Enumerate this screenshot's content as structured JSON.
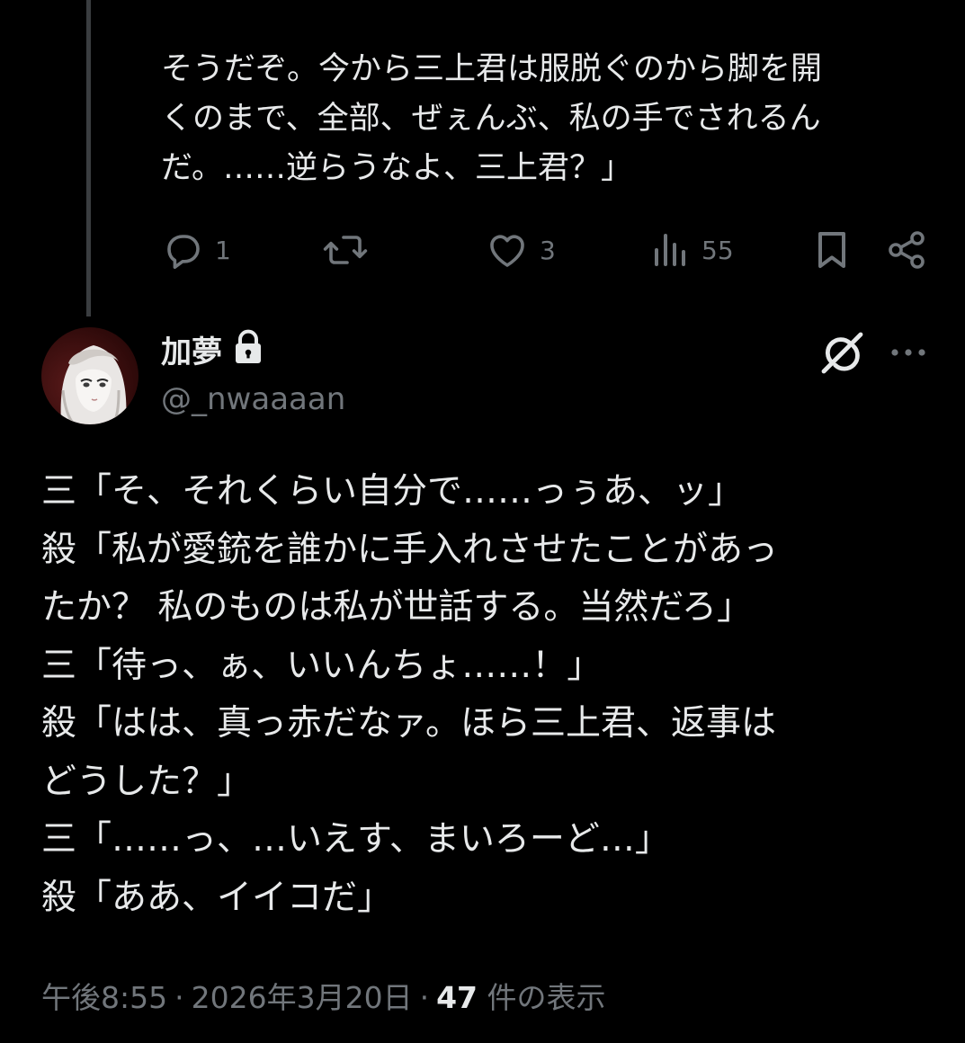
{
  "previous_post": {
    "lines": [
      "そうだぞ。今から三上君は服脱ぐのから脚を開",
      "くのまで、全部、ぜぇんぶ、私の手でされるん",
      "だ。……逆らうなよ、三上君？」"
    ],
    "actions": {
      "reply_count": "1",
      "repost_count": "",
      "like_count": "3",
      "views_count": "55"
    }
  },
  "post": {
    "author": {
      "display_name": "加夢",
      "handle": "@_nwaaaan"
    },
    "lines": [
      "三「そ、それくらい自分で……っぅあ、ッ」",
      "殺「私が愛銃を誰かに手入れさせたことがあっ",
      "たか？ 私のものは私が世話する。当然だろ」",
      "三「待っ、ぁ、いいんちょ……！」",
      "殺「はは、真っ赤だなァ。ほら三上君、返事は",
      "どうした？」",
      "三「……っ、…いえす、まいろーど…」",
      "殺「ああ、イイコだ」"
    ],
    "meta": {
      "time": "午後8:55",
      "separator": "·",
      "date": "2026年3月20日",
      "views_count": "47",
      "views_label": "件の表示"
    }
  },
  "icons": {
    "reply": "reply-icon",
    "repost": "repost-icon",
    "like": "heart-icon",
    "views": "bar-chart-icon",
    "bookmark": "bookmark-icon",
    "share": "share-icon",
    "lock": "lock-icon",
    "grok": "grok-icon",
    "more": "more-icon"
  },
  "colors": {
    "background": "#000000",
    "text_primary": "#e7e9ea",
    "text_secondary": "#71767b",
    "thread_line": "#3a3d40"
  }
}
